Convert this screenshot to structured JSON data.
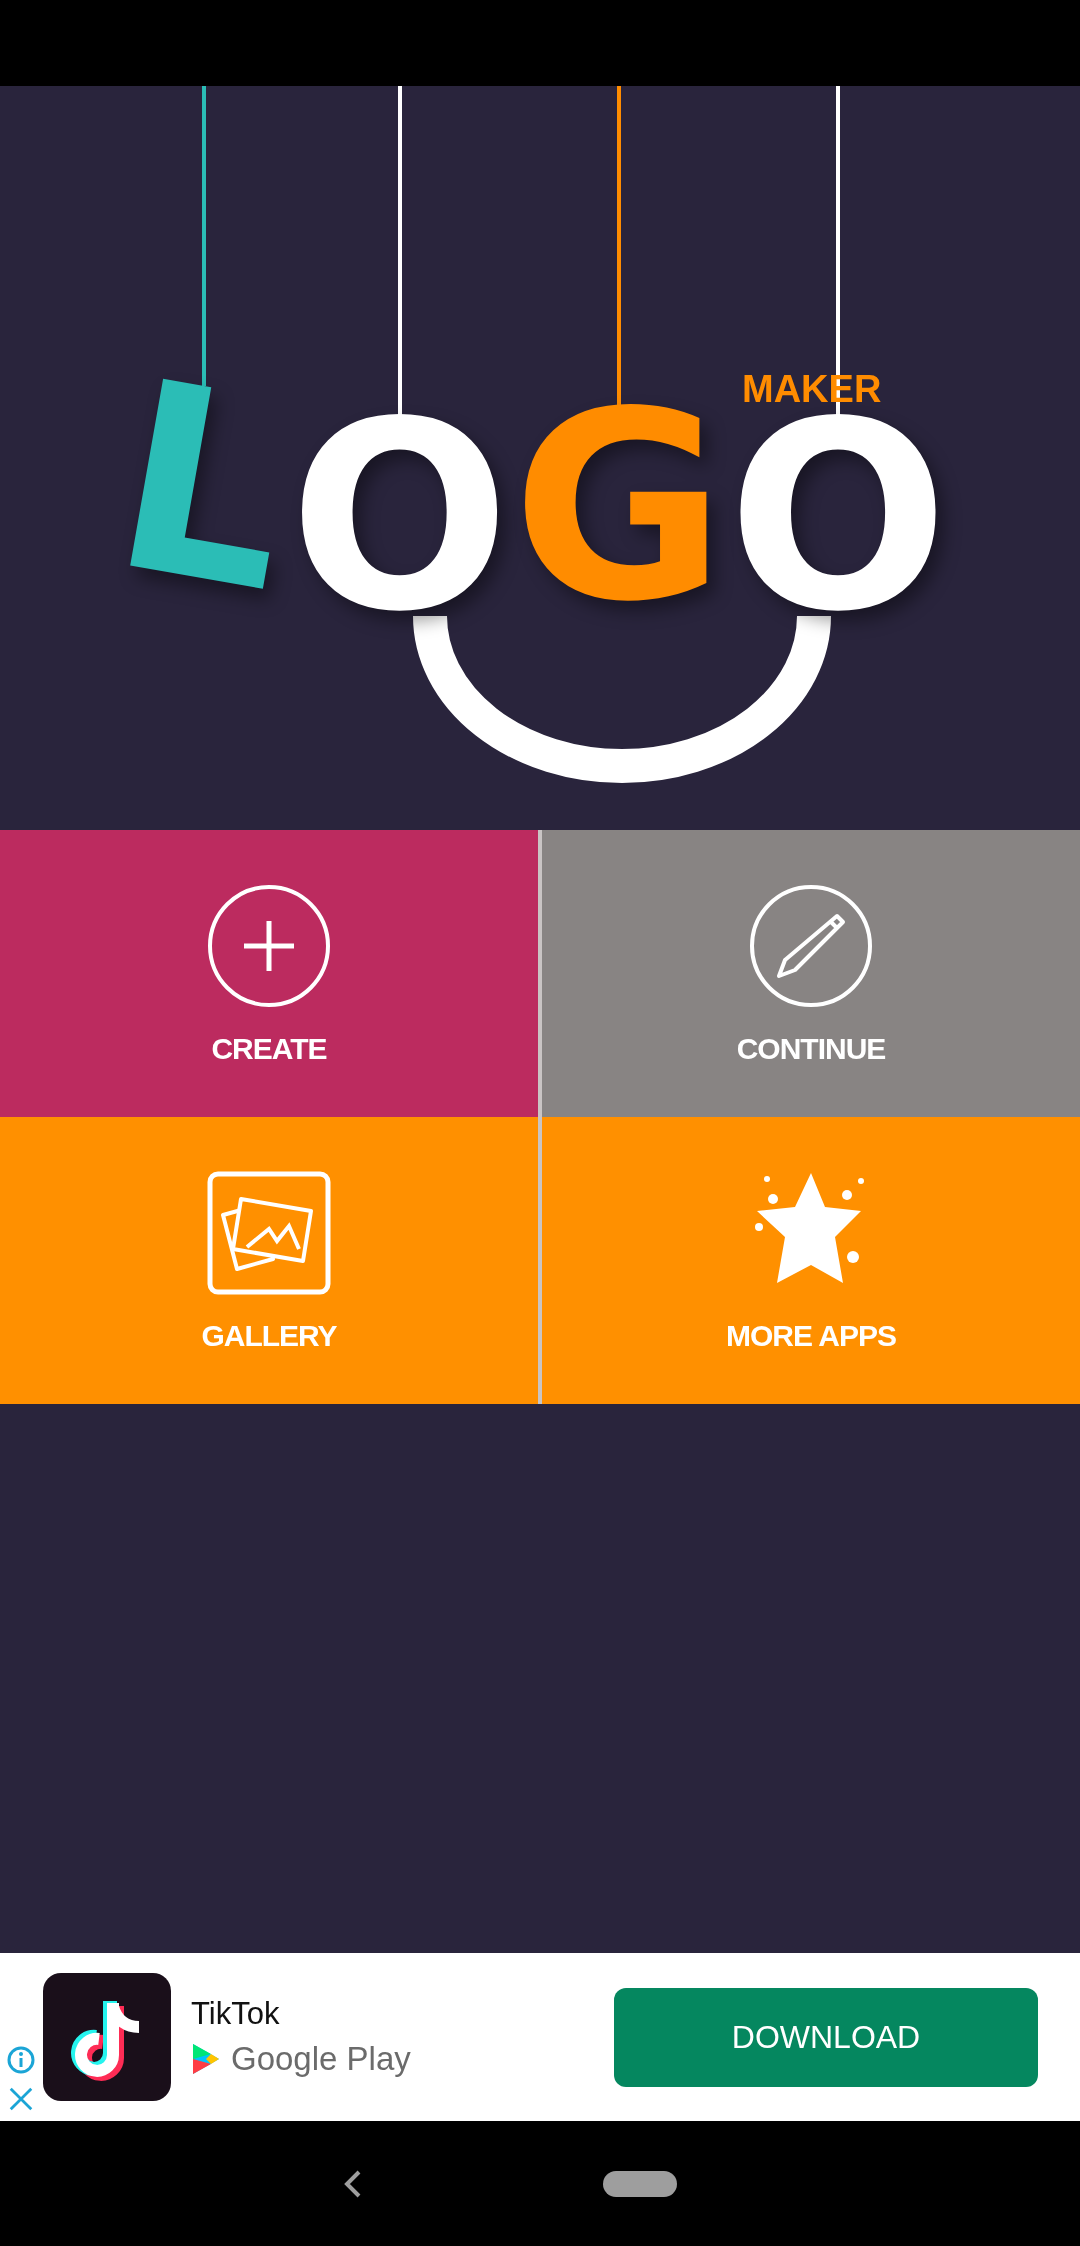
{
  "logo": {
    "letters": [
      {
        "char": "L",
        "color": "#2bbdb6"
      },
      {
        "char": "O",
        "color": "#ffffff"
      },
      {
        "char": "G",
        "color": "#ff8c00"
      },
      {
        "char": "O",
        "color": "#ffffff"
      }
    ],
    "subtitle": "MAKER"
  },
  "tiles": [
    {
      "label": "CREATE",
      "color": "#bc2b5f"
    },
    {
      "label": "CONTINUE",
      "color": "#888483"
    },
    {
      "label": "GALLERY",
      "color": "#ff9000"
    },
    {
      "label": "MORE APPS",
      "color": "#ff9000"
    }
  ],
  "ad": {
    "app_name": "TikTok",
    "store": "Google Play",
    "button": "DOWNLOAD"
  }
}
